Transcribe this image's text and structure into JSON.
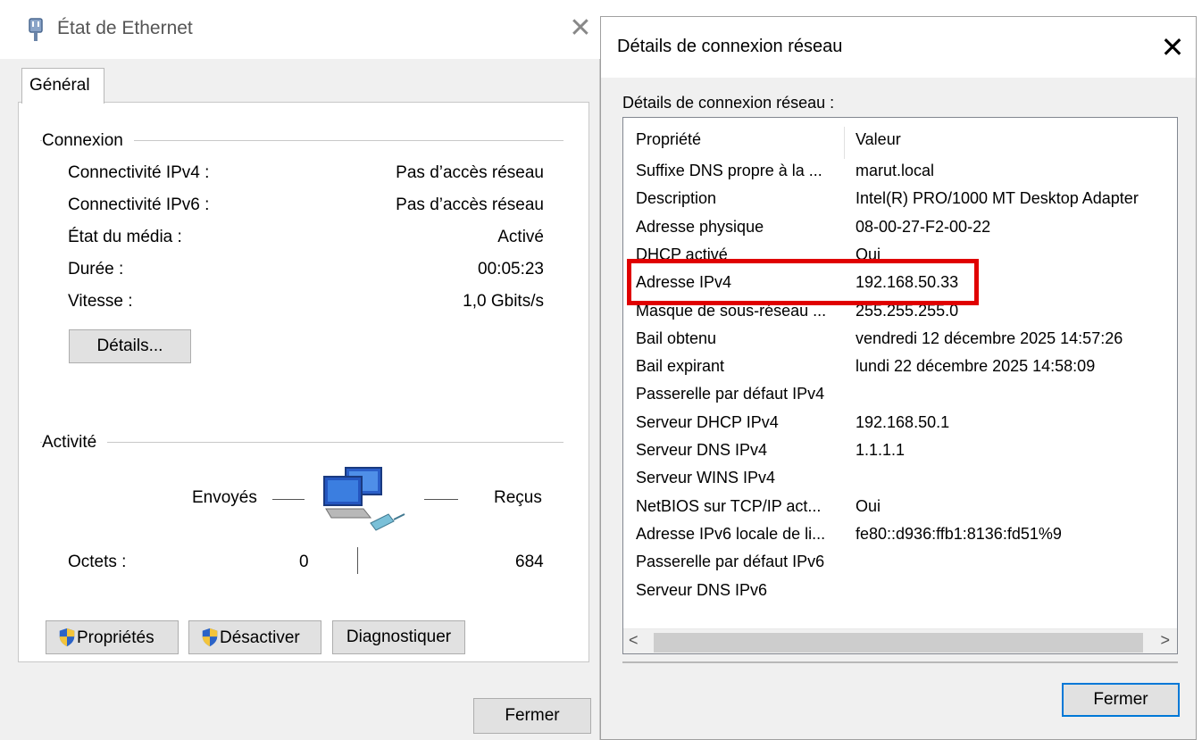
{
  "left": {
    "title": "État de Ethernet",
    "close_glyph": "✕",
    "tab": "Général",
    "connection": {
      "group_label": "Connexion",
      "rows": [
        {
          "label": "Connectivité IPv4 :",
          "value": "Pas d’accès réseau"
        },
        {
          "label": "Connectivité IPv6 :",
          "value": "Pas d’accès réseau"
        },
        {
          "label": "État du média :",
          "value": "Activé"
        },
        {
          "label": "Durée :",
          "value": "00:05:23"
        },
        {
          "label": "Vitesse :",
          "value": "1,0 Gbits/s"
        }
      ],
      "details_button": "Détails..."
    },
    "activity": {
      "group_label": "Activité",
      "sent_label": "Envoyés",
      "received_label": "Reçus",
      "bytes_label": "Octets :",
      "bytes_sent": "0",
      "bytes_received": "684"
    },
    "buttons": {
      "properties": "Propriétés",
      "disable": "Désactiver",
      "diagnose": "Diagnostiquer"
    },
    "close_button": "Fermer"
  },
  "right": {
    "title": "Détails de connexion réseau",
    "close_glyph": "✕",
    "subtitle": "Détails de connexion réseau :",
    "columns": {
      "property": "Propriété",
      "value": "Valeur"
    },
    "rows": [
      {
        "prop": "Suffixe DNS propre à la ...",
        "val": "marut.local"
      },
      {
        "prop": "Description",
        "val": "Intel(R) PRO/1000 MT Desktop Adapter"
      },
      {
        "prop": "Adresse physique",
        "val": "08-00-27-F2-00-22"
      },
      {
        "prop": "DHCP activé",
        "val": "Oui"
      },
      {
        "prop": "Adresse IPv4",
        "val": "192.168.50.33"
      },
      {
        "prop": "Masque de sous-réseau ...",
        "val": "255.255.255.0"
      },
      {
        "prop": "Bail obtenu",
        "val": "vendredi 12 décembre 2025 14:57:26"
      },
      {
        "prop": "Bail expirant",
        "val": "lundi 22 décembre 2025 14:58:09"
      },
      {
        "prop": "Passerelle par défaut IPv4",
        "val": ""
      },
      {
        "prop": "Serveur DHCP IPv4",
        "val": "192.168.50.1"
      },
      {
        "prop": "Serveur DNS IPv4",
        "val": "1.1.1.1"
      },
      {
        "prop": "Serveur WINS IPv4",
        "val": ""
      },
      {
        "prop": "NetBIOS sur TCP/IP act...",
        "val": "Oui"
      },
      {
        "prop": "Adresse IPv6 locale de li...",
        "val": "fe80::d936:ffb1:8136:fd51%9"
      },
      {
        "prop": "Passerelle par défaut IPv6",
        "val": ""
      },
      {
        "prop": "Serveur DNS IPv6",
        "val": ""
      }
    ],
    "scroll_left": "<",
    "scroll_right": ">",
    "close_button": "Fermer"
  },
  "colors": {
    "highlight": "#e00000",
    "dialog_bg": "#f0f0f0",
    "default_button_border": "#0078d7"
  }
}
